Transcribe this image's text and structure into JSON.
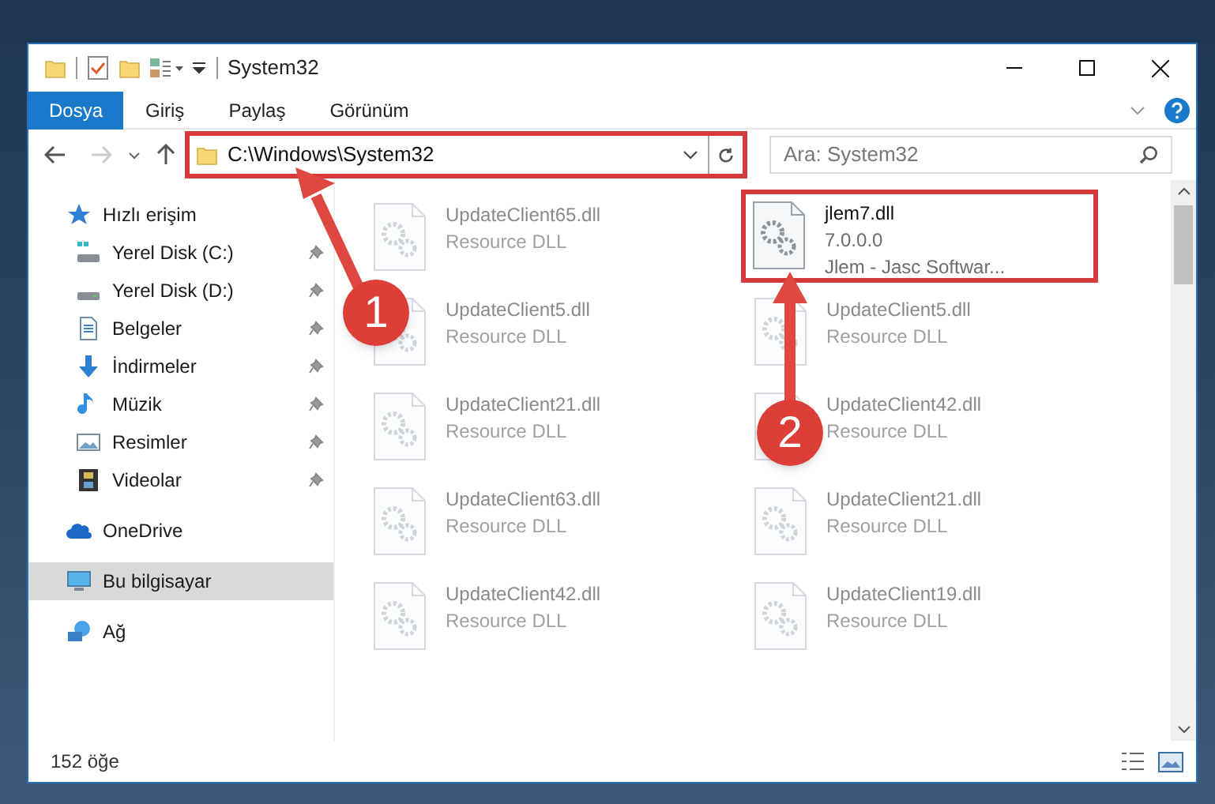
{
  "window": {
    "title": "System32"
  },
  "ribbon_tabs": [
    {
      "label": "Dosya",
      "kind": "file_menu"
    },
    {
      "label": "Giriş",
      "kind": "tab"
    },
    {
      "label": "Paylaş",
      "kind": "tab"
    },
    {
      "label": "Görünüm",
      "kind": "tab"
    }
  ],
  "address_bar": {
    "path": "C:\\Windows\\System32",
    "highlighted": true
  },
  "search": {
    "placeholder": "Ara: System32"
  },
  "navigation": [
    {
      "label": "Hızlı erişim",
      "selected": false,
      "children": [
        {
          "label": "Yerel Disk (C:)",
          "pinned": true,
          "selected": false
        },
        {
          "label": "Yerel Disk (D:)",
          "pinned": true,
          "selected": false
        },
        {
          "label": "Belgeler",
          "pinned": true,
          "selected": false
        },
        {
          "label": "İndirmeler",
          "pinned": true,
          "selected": false
        },
        {
          "label": "Müzik",
          "pinned": true,
          "selected": false
        },
        {
          "label": "Resimler",
          "pinned": true,
          "selected": false
        },
        {
          "label": "Videolar",
          "pinned": true,
          "selected": false
        }
      ]
    },
    {
      "label": "OneDrive",
      "selected": false
    },
    {
      "label": "Bu bilgisayar",
      "selected": true
    },
    {
      "label": "Ağ",
      "selected": false
    }
  ],
  "files": [
    {
      "name": "UpdateClient65.dll",
      "lines": [
        "Resource DLL"
      ],
      "faded": true,
      "highlighted": false
    },
    {
      "name": "jlem7.dll",
      "lines": [
        "7.0.0.0",
        "Jlem - Jasc Softwar..."
      ],
      "faded": false,
      "highlighted": true
    },
    {
      "name": "UpdateClient5.dll",
      "lines": [
        "Resource DLL"
      ],
      "faded": true,
      "highlighted": false
    },
    {
      "name": "UpdateClient5.dll",
      "lines": [
        "Resource DLL"
      ],
      "faded": true,
      "highlighted": false
    },
    {
      "name": "UpdateClient21.dll",
      "lines": [
        "Resource DLL"
      ],
      "faded": true,
      "highlighted": false
    },
    {
      "name": "UpdateClient42.dll",
      "lines": [
        "Resource DLL"
      ],
      "faded": true,
      "highlighted": false
    },
    {
      "name": "UpdateClient63.dll",
      "lines": [
        "Resource DLL"
      ],
      "faded": true,
      "highlighted": false
    },
    {
      "name": "UpdateClient21.dll",
      "lines": [
        "Resource DLL"
      ],
      "faded": true,
      "highlighted": false
    },
    {
      "name": "UpdateClient42.dll",
      "lines": [
        "Resource DLL"
      ],
      "faded": true,
      "highlighted": false
    },
    {
      "name": "UpdateClient19.dll",
      "lines": [
        "Resource DLL"
      ],
      "faded": true,
      "highlighted": false
    }
  ],
  "status_bar": {
    "item_count": "152 öğe"
  },
  "annotations": [
    {
      "number": "1"
    },
    {
      "number": "2"
    }
  ]
}
